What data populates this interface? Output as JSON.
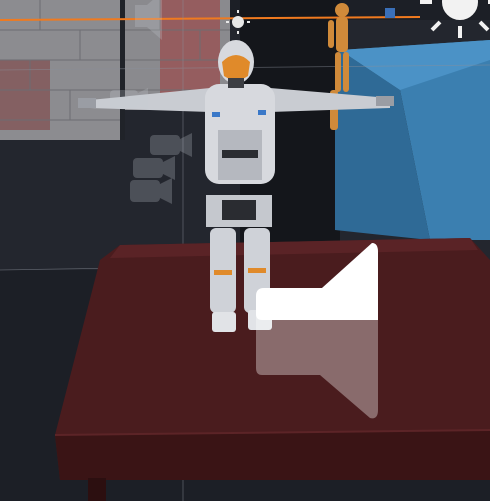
{
  "viewport": {
    "label": ""
  },
  "scene": {
    "objects": [
      {
        "name": "brick-wall",
        "type": "environment"
      },
      {
        "name": "robot-character",
        "type": "character",
        "pose": "T-pose",
        "accent_color": "#e08a2a"
      },
      {
        "name": "wooden-mannequin",
        "type": "character",
        "color": "#d08a3a"
      },
      {
        "name": "blue-platform",
        "type": "environment",
        "color": "#3b7fb0"
      },
      {
        "name": "red-table",
        "type": "prop",
        "color": "#4a1c1e"
      }
    ],
    "gizmos": [
      {
        "name": "camera-icon",
        "count": 4
      },
      {
        "name": "sun-light-icon",
        "count": 2
      },
      {
        "name": "audio-source-icon",
        "count": 2
      }
    ]
  },
  "colors": {
    "background": "#1c1f26",
    "horizon_line": "#f07a1f",
    "grid_line": "#8a8f99",
    "table": "#4a1c1e"
  }
}
